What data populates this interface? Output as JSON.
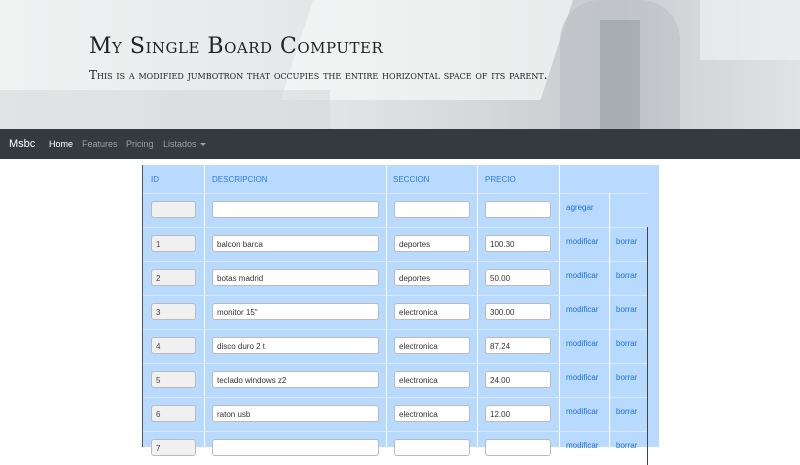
{
  "jumbotron": {
    "title": "My Single Board Computer",
    "lead": "This is a modified jumbotron that occupies the entire horizontal space of its parent."
  },
  "navbar": {
    "brand": "Msbc",
    "items": [
      "Home",
      "Features",
      "Pricing",
      "Listados"
    ]
  },
  "table": {
    "headers": [
      "ID",
      "DESCRIPCION",
      "SECCION",
      "PRECIO"
    ],
    "add_label": "agregar",
    "modify_label": "modificar",
    "delete_label": "borrar",
    "new_row": {
      "id": "",
      "descripcion": "",
      "seccion": "",
      "precio": ""
    },
    "rows": [
      {
        "id": "1",
        "descripcion": "balcon barca",
        "seccion": "deportes",
        "precio": "100.30"
      },
      {
        "id": "2",
        "descripcion": "botas madrid",
        "seccion": "deportes",
        "precio": "50.00"
      },
      {
        "id": "3",
        "descripcion": "monitor 15\"",
        "seccion": "electronica",
        "precio": "300.00"
      },
      {
        "id": "4",
        "descripcion": "disco duro 2 t",
        "seccion": "electronica",
        "precio": "87.24"
      },
      {
        "id": "5",
        "descripcion": "teclado windows z2",
        "seccion": "electronica",
        "precio": "24.00"
      },
      {
        "id": "6",
        "descripcion": "raton usb",
        "seccion": "electronica",
        "precio": "12.00"
      },
      {
        "id": "7",
        "descripcion": "",
        "seccion": "",
        "precio": ""
      }
    ]
  }
}
